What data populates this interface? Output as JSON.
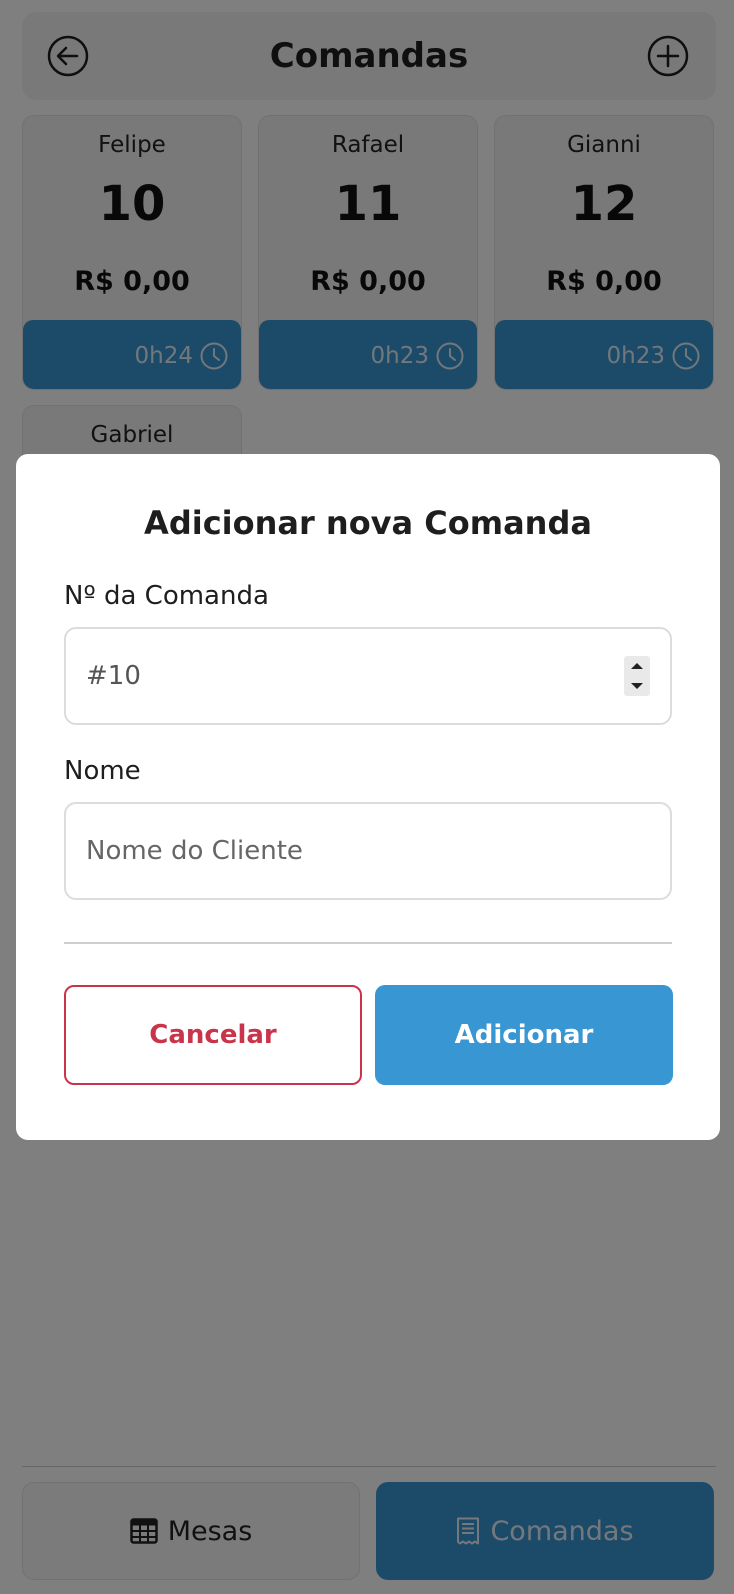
{
  "header": {
    "title": "Comandas"
  },
  "cards": [
    {
      "name": "Felipe",
      "number": "10",
      "value": "R$ 0,00",
      "time": "0h24"
    },
    {
      "name": "Rafael",
      "number": "11",
      "value": "R$ 0,00",
      "time": "0h23"
    },
    {
      "name": "Gianni",
      "number": "12",
      "value": "R$ 0,00",
      "time": "0h23"
    },
    {
      "name": "Gabriel"
    }
  ],
  "modal": {
    "title": "Adicionar nova Comanda",
    "number_label": "Nº da Comanda",
    "number_value": "#10",
    "name_label": "Nome",
    "name_placeholder": "Nome do Cliente",
    "cancel_label": "Cancelar",
    "add_label": "Adicionar"
  },
  "nav": {
    "mesas_label": "Mesas",
    "comandas_label": "Comandas"
  },
  "colors": {
    "accent": "#3896d3",
    "danger": "#c9344b",
    "overlay": "rgba(0,0,0,0.5)"
  },
  "icons": [
    "back-arrow-icon",
    "plus-circle-icon",
    "clock-icon",
    "table-grid-icon",
    "receipt-icon",
    "stepper-up-icon",
    "stepper-down-icon"
  ]
}
